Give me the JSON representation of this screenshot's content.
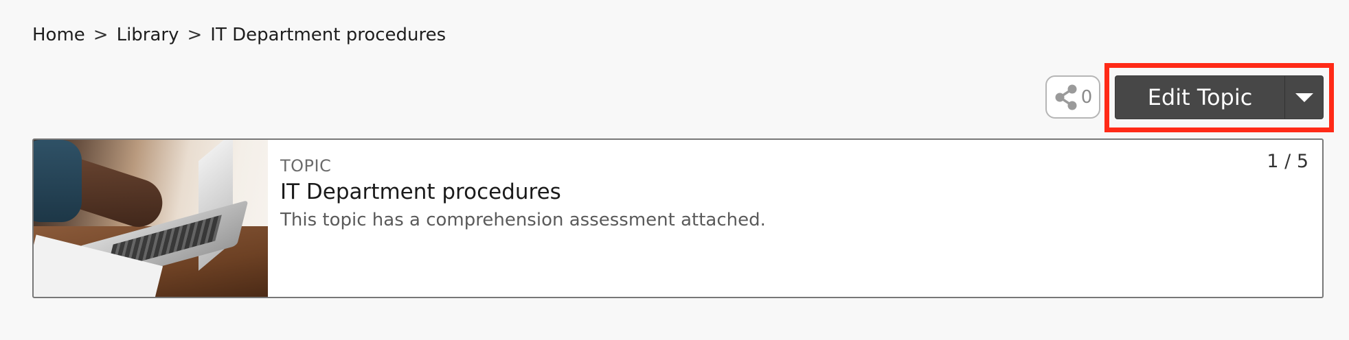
{
  "breadcrumb": {
    "items": [
      "Home",
      "Library",
      "IT Department procedures"
    ],
    "separator": ">"
  },
  "share": {
    "icon": "share-icon",
    "count": "0"
  },
  "edit_button": {
    "label": "Edit Topic",
    "caret_icon": "caret-down-icon"
  },
  "card": {
    "type_label": "TOPIC",
    "title": "IT Department procedures",
    "description": "This topic has a comprehension assessment attached.",
    "position": "1 / 5",
    "thumbnail": "laptop-typing-photo"
  },
  "colors": {
    "highlight": "#ff2a17",
    "button_bg": "#474747",
    "page_bg": "#f8f8f8"
  }
}
